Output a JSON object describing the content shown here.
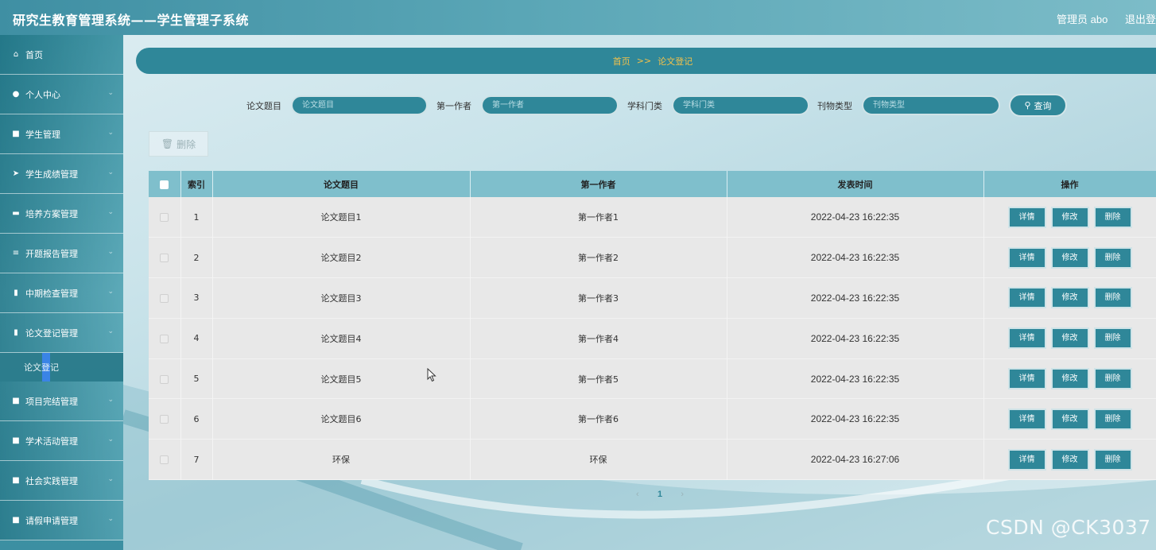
{
  "app": {
    "title": "研究生教育管理系统——学生管理子系统"
  },
  "user": {
    "label": "管理员 abo",
    "logout": "退出登"
  },
  "sidebar": {
    "items": [
      {
        "label": "首页",
        "icon": "home-icon",
        "glyph": "⌂"
      },
      {
        "label": "个人中心",
        "icon": "user-icon",
        "glyph": "●"
      },
      {
        "label": "学生管理",
        "icon": "grid-icon",
        "glyph": "■"
      },
      {
        "label": "学生成绩管理",
        "icon": "send-icon",
        "glyph": "➤"
      },
      {
        "label": "培养方案管理",
        "icon": "comment-icon",
        "glyph": "▬"
      },
      {
        "label": "开题报告管理",
        "icon": "list-icon",
        "glyph": "≡"
      },
      {
        "label": "中期检查管理",
        "icon": "clipboard-icon",
        "glyph": "▮"
      },
      {
        "label": "论文登记管理",
        "icon": "bar-chart-icon",
        "glyph": "▮"
      },
      {
        "label": "项目完结管理",
        "icon": "grid-icon",
        "glyph": "■"
      },
      {
        "label": "学术活动管理",
        "icon": "grid-icon",
        "glyph": "■"
      },
      {
        "label": "社会实践管理",
        "icon": "grid-icon",
        "glyph": "■"
      },
      {
        "label": "请假申请管理",
        "icon": "grid-icon",
        "glyph": "■"
      }
    ],
    "sub_item": "论文登记"
  },
  "breadcrumb": {
    "home": "首页",
    "sep": ">>",
    "current": "论文登记"
  },
  "search": {
    "title_label": "论文题目",
    "title_placeholder": "论文题目",
    "author_label": "第一作者",
    "author_placeholder": "第一作者",
    "subject_label": "学科门类",
    "subject_placeholder": "学科门类",
    "journal_label": "刊物类型",
    "journal_placeholder": "刊物类型",
    "button": "查询"
  },
  "toolbar": {
    "delete_label": "删除"
  },
  "table": {
    "headers": [
      "索引",
      "论文题目",
      "第一作者",
      "发表时间",
      "操作"
    ],
    "rows": [
      {
        "index": "1",
        "title": "论文题目1",
        "author": "第一作者1",
        "time": "2022-04-23 16:22:35"
      },
      {
        "index": "2",
        "title": "论文题目2",
        "author": "第一作者2",
        "time": "2022-04-23 16:22:35"
      },
      {
        "index": "3",
        "title": "论文题目3",
        "author": "第一作者3",
        "time": "2022-04-23 16:22:35"
      },
      {
        "index": "4",
        "title": "论文题目4",
        "author": "第一作者4",
        "time": "2022-04-23 16:22:35"
      },
      {
        "index": "5",
        "title": "论文题目5",
        "author": "第一作者5",
        "time": "2022-04-23 16:22:35"
      },
      {
        "index": "6",
        "title": "论文题目6",
        "author": "第一作者6",
        "time": "2022-04-23 16:22:35"
      },
      {
        "index": "7",
        "title": "环保",
        "author": "环保",
        "time": "2022-04-23 16:27:06"
      }
    ],
    "actions": {
      "detail": "详情",
      "edit": "修改",
      "delete": "删除"
    }
  },
  "pager": {
    "prev": "‹",
    "page": "1",
    "next": "›"
  },
  "watermark": "CSDN @CK3037",
  "colors": {
    "accent": "#2f8799",
    "breadcrumb_text": "#f2c14b",
    "header_row": "#7fbfcc"
  }
}
